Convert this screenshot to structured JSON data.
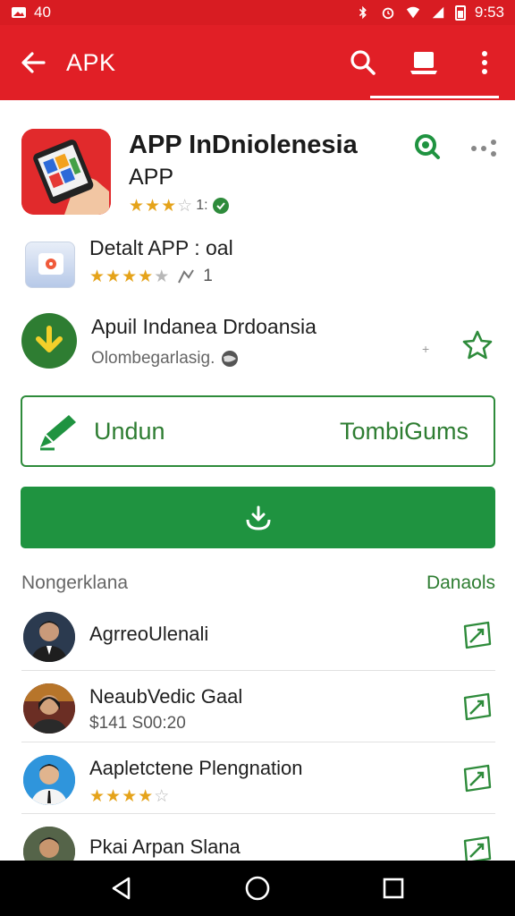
{
  "status_bar": {
    "left_text": "40",
    "right_text": "9:53"
  },
  "app_bar": {
    "title": "APK"
  },
  "top_app": {
    "title": "APP InDniolenesia",
    "subtitle": "APP",
    "rating_text": "1:",
    "stars": 3
  },
  "detail": {
    "title": "Detalt APP : oal",
    "rating_count": "1",
    "stars": 4.5
  },
  "install": {
    "title": "Apuil Indanea Drdoansia",
    "subtitle": "Olombegarlasig.",
    "tiny": "+"
  },
  "outline_button": {
    "left_label": "Undun",
    "right_label": "TombiGums"
  },
  "section": {
    "title": "Nongerklana",
    "link": "Danaols"
  },
  "list": [
    {
      "title": "AgrreoUlenali",
      "subtitle": ""
    },
    {
      "title": "NeaubVedic Gaal",
      "subtitle": "$141 S00:20"
    },
    {
      "title": "Aapletctene Plengnation",
      "subtitle": "",
      "stars": 3.5
    },
    {
      "title": "Pkai Arpan Slana",
      "subtitle": ""
    }
  ],
  "colors": {
    "primary_red": "#e11f26",
    "status_red": "#d81c22",
    "accent_green": "#1f9340",
    "star_gold": "#e5a31a"
  },
  "icons": {
    "back": "arrow-left-icon",
    "search": "search-icon",
    "cast": "cast-icon",
    "more": "more-vert-icon"
  }
}
